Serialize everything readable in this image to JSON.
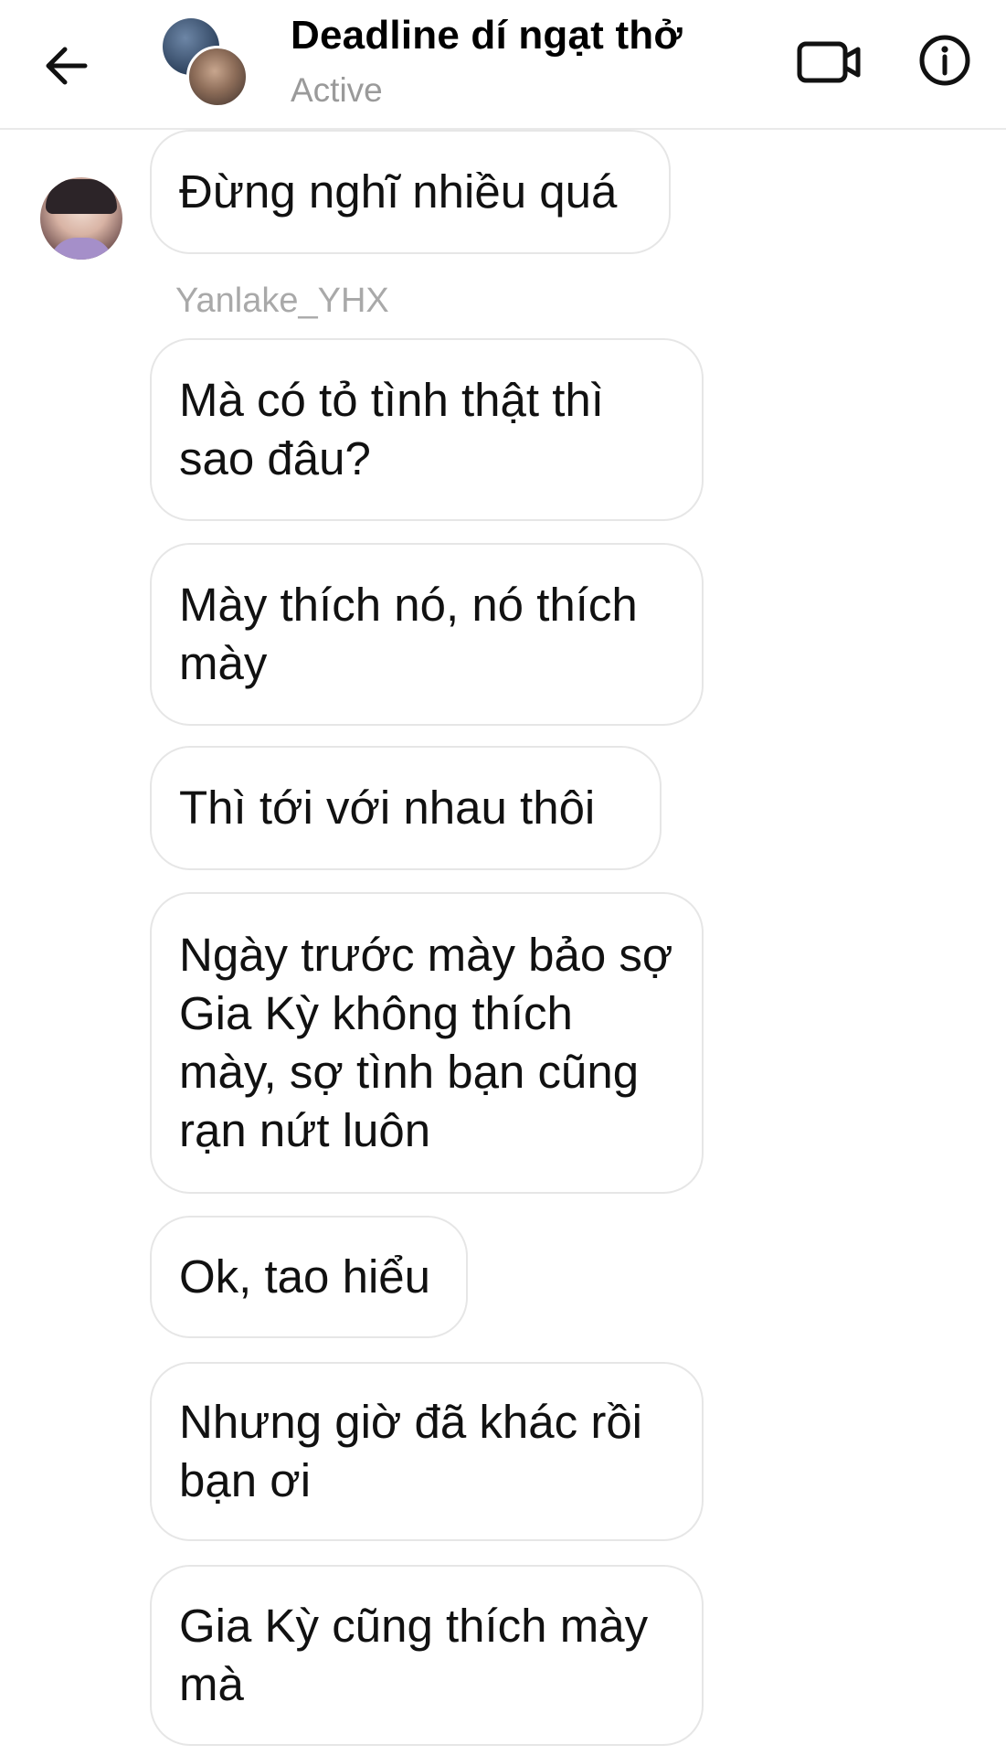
{
  "header": {
    "title": "Deadline dí ngạt thở",
    "status": "Active",
    "icons": {
      "back": "arrow-left-icon",
      "video": "video-camera-icon",
      "info": "info-circle-icon"
    }
  },
  "conversation": {
    "first_message": "Đừng nghĩ nhiều quá",
    "sender_name": "Yanlake_YHX",
    "messages": [
      "Mà có tỏ tình thật thì sao đâu?",
      "Mày thích nó, nó thích mày",
      "Thì tới với nhau thôi",
      "Ngày trước mày bảo sợ Gia Kỳ không thích mày, sợ tình bạn cũng rạn nứt luôn",
      "Ok, tao hiểu",
      "Nhưng giờ đã khác rồi bạn ơi",
      "Gia Kỳ cũng thích mày mà"
    ]
  },
  "colors": {
    "bubble_border": "#e6e6e6",
    "muted_text": "#9a9a9a",
    "header_divider": "#e9e9e9"
  }
}
